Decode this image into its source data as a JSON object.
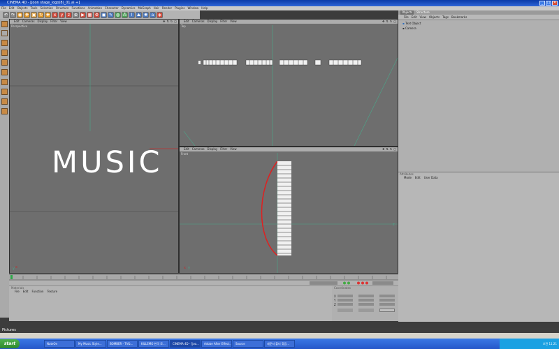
{
  "window": {
    "title": "CINEMA 4D - [joon stage_logo(8)_01.ai +]",
    "controls": [
      "_",
      "□",
      "✕"
    ]
  },
  "menubar": [
    "File",
    "Edit",
    "Objects",
    "Tools",
    "Selection",
    "Structure",
    "Functions",
    "Animation",
    "Character",
    "Dynamics",
    "MoGraph",
    "Hair",
    "Render",
    "Plugins",
    "Window",
    "Help"
  ],
  "viewport_menu": [
    "Edit",
    "Cameras",
    "Display",
    "Filter",
    "View"
  ],
  "viewports": {
    "perspective": {
      "label": "Perspective",
      "text3d": "MUSIC"
    },
    "top": {
      "label": "Top"
    },
    "front": {
      "label": "Front"
    }
  },
  "object_manager": {
    "tabs": [
      "Objects",
      "Structure"
    ],
    "menu": [
      "File",
      "Edit",
      "View",
      "Objects",
      "Tags",
      "Bookmarks"
    ],
    "objects": [
      "Text Object",
      "Camera"
    ]
  },
  "attributes": {
    "title": "Attributes",
    "menu": [
      "Mode",
      "Edit",
      "User Data"
    ]
  },
  "materials": {
    "title": "Materials",
    "menu": [
      "File",
      "Edit",
      "Function",
      "Texture"
    ]
  },
  "coordinates": {
    "title": "Coordinates",
    "rows": [
      "X",
      "Y",
      "Z"
    ]
  },
  "pictures_label": "Pictures",
  "taskbar": {
    "start": "start",
    "tasks": [
      "NateOn",
      "My Music Style...",
      "BOMBER - TV&...",
      "KILLEMO 한국 로...",
      "CINEMA 4D - [joo...",
      "Adobe After Effect...",
      "Source",
      "내문서 폴더 찾음..."
    ],
    "active_index": 4,
    "tray": "오전 11:21"
  },
  "colors": {
    "titlebar": "#0a3aa8",
    "viewport_bg": "#6e6e6e",
    "spline_red": "#e02020",
    "axis_green": "#4aa88a"
  }
}
